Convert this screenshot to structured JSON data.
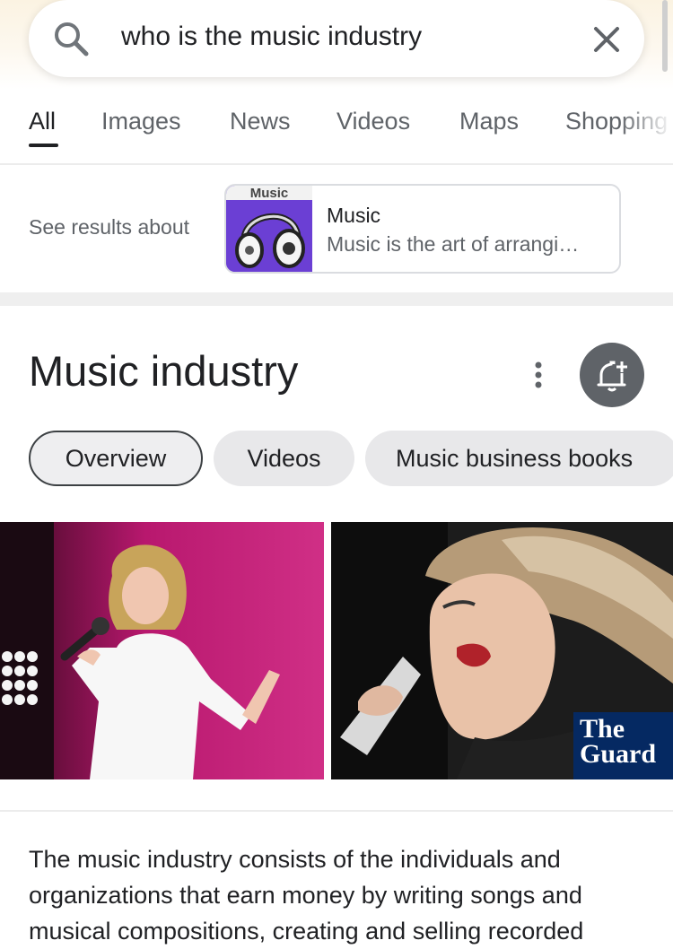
{
  "search": {
    "query": "who is the music industry"
  },
  "tabs": [
    {
      "label": "All",
      "active": true
    },
    {
      "label": "Images"
    },
    {
      "label": "News"
    },
    {
      "label": "Videos"
    },
    {
      "label": "Maps"
    },
    {
      "label": "Shopping"
    }
  ],
  "see_results": {
    "label": "See results about",
    "card": {
      "thumb_text": "Music",
      "title": "Music",
      "description": "Music is the art of arrangi…"
    }
  },
  "knowledge_panel": {
    "title": "Music industry",
    "chips": [
      {
        "label": "Overview",
        "selected": true
      },
      {
        "label": "Videos"
      },
      {
        "label": "Music business books"
      }
    ],
    "photo_badge": "The Guard",
    "description": "The music industry consists of the individuals and organizations that earn money by writing songs and musical compositions, creating and selling recorded"
  },
  "colors": {
    "accent_dark": "#202124",
    "secondary_text": "#5f6368",
    "card_thumb": "#6b3fd4",
    "photo1_bg": "#b8186e",
    "guardian_blue": "#052962"
  },
  "icons": [
    "search-icon",
    "close-icon",
    "more-vert-icon",
    "add-alert-icon",
    "headphones-icon"
  ]
}
